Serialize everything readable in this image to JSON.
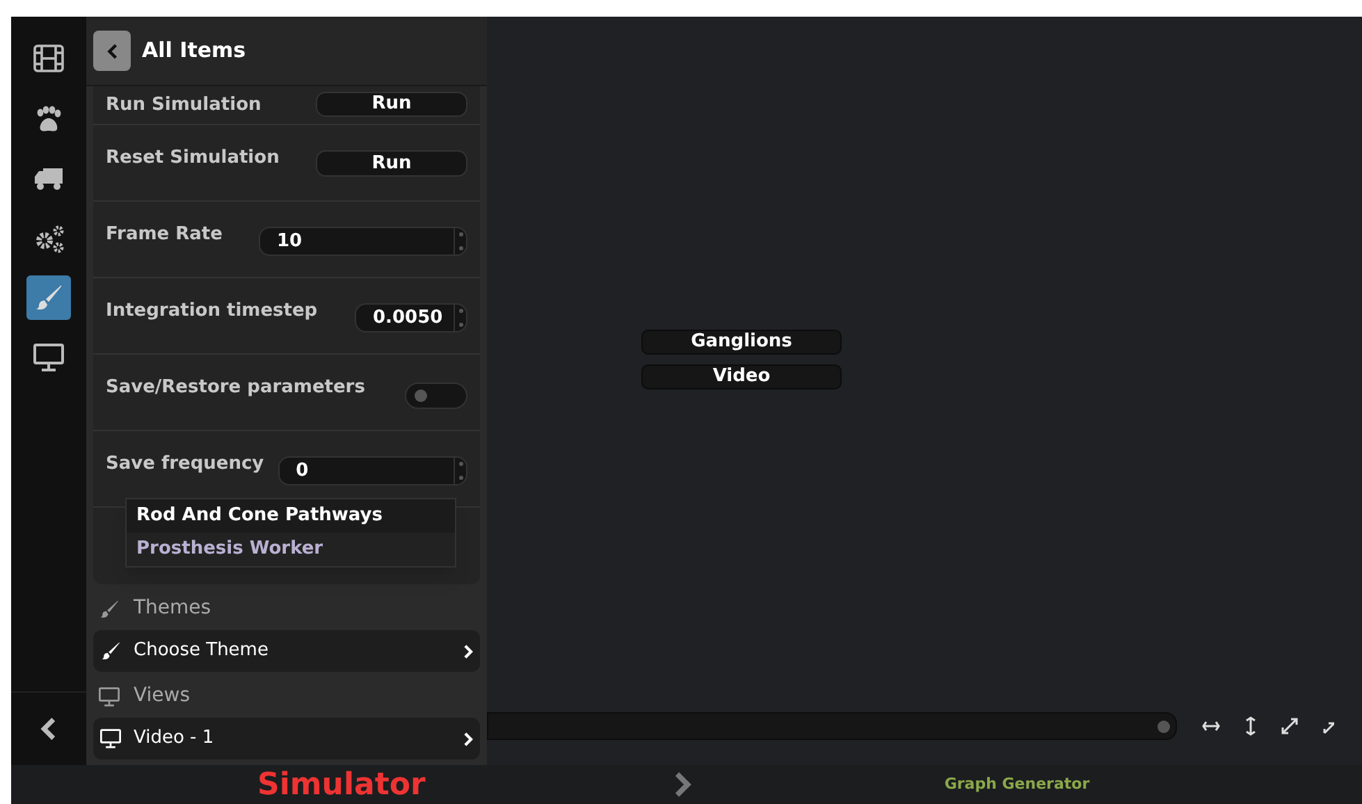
{
  "rail": {
    "items": [
      {
        "kind": "film",
        "selected": false
      },
      {
        "kind": "paw",
        "selected": false
      },
      {
        "kind": "truck",
        "selected": false
      },
      {
        "kind": "gears",
        "selected": false
      },
      {
        "kind": "brush",
        "selected": true
      },
      {
        "kind": "monitor",
        "selected": false
      }
    ]
  },
  "panel": {
    "title": "All Items",
    "rows": [
      {
        "kind": "button",
        "label": "Run Simulation",
        "value": "Run"
      },
      {
        "kind": "button",
        "label": "Reset Simulation",
        "value": "Run"
      },
      {
        "kind": "number",
        "label": "Frame Rate",
        "value": "10"
      },
      {
        "kind": "number",
        "label": "Integration timestep",
        "value": "0.0050"
      },
      {
        "kind": "toggle",
        "label": "Save/Restore parameters",
        "on": false
      },
      {
        "kind": "number",
        "label": "Save frequency",
        "value": "0"
      }
    ],
    "dropdown": [
      {
        "label": "Rod And Cone Pathways",
        "selected": false
      },
      {
        "label": "Prosthesis Worker",
        "selected": true
      }
    ],
    "sections": [
      {
        "kind": "brush",
        "title": "Themes",
        "item": "Choose Theme"
      },
      {
        "kind": "monitor",
        "title": "Views",
        "item": "Video - 1"
      }
    ]
  },
  "canvas": {
    "nodes": [
      "Ganglions",
      "Video"
    ]
  },
  "bottom_bar": {
    "current": "Simulator",
    "next": "Graph Generator"
  }
}
